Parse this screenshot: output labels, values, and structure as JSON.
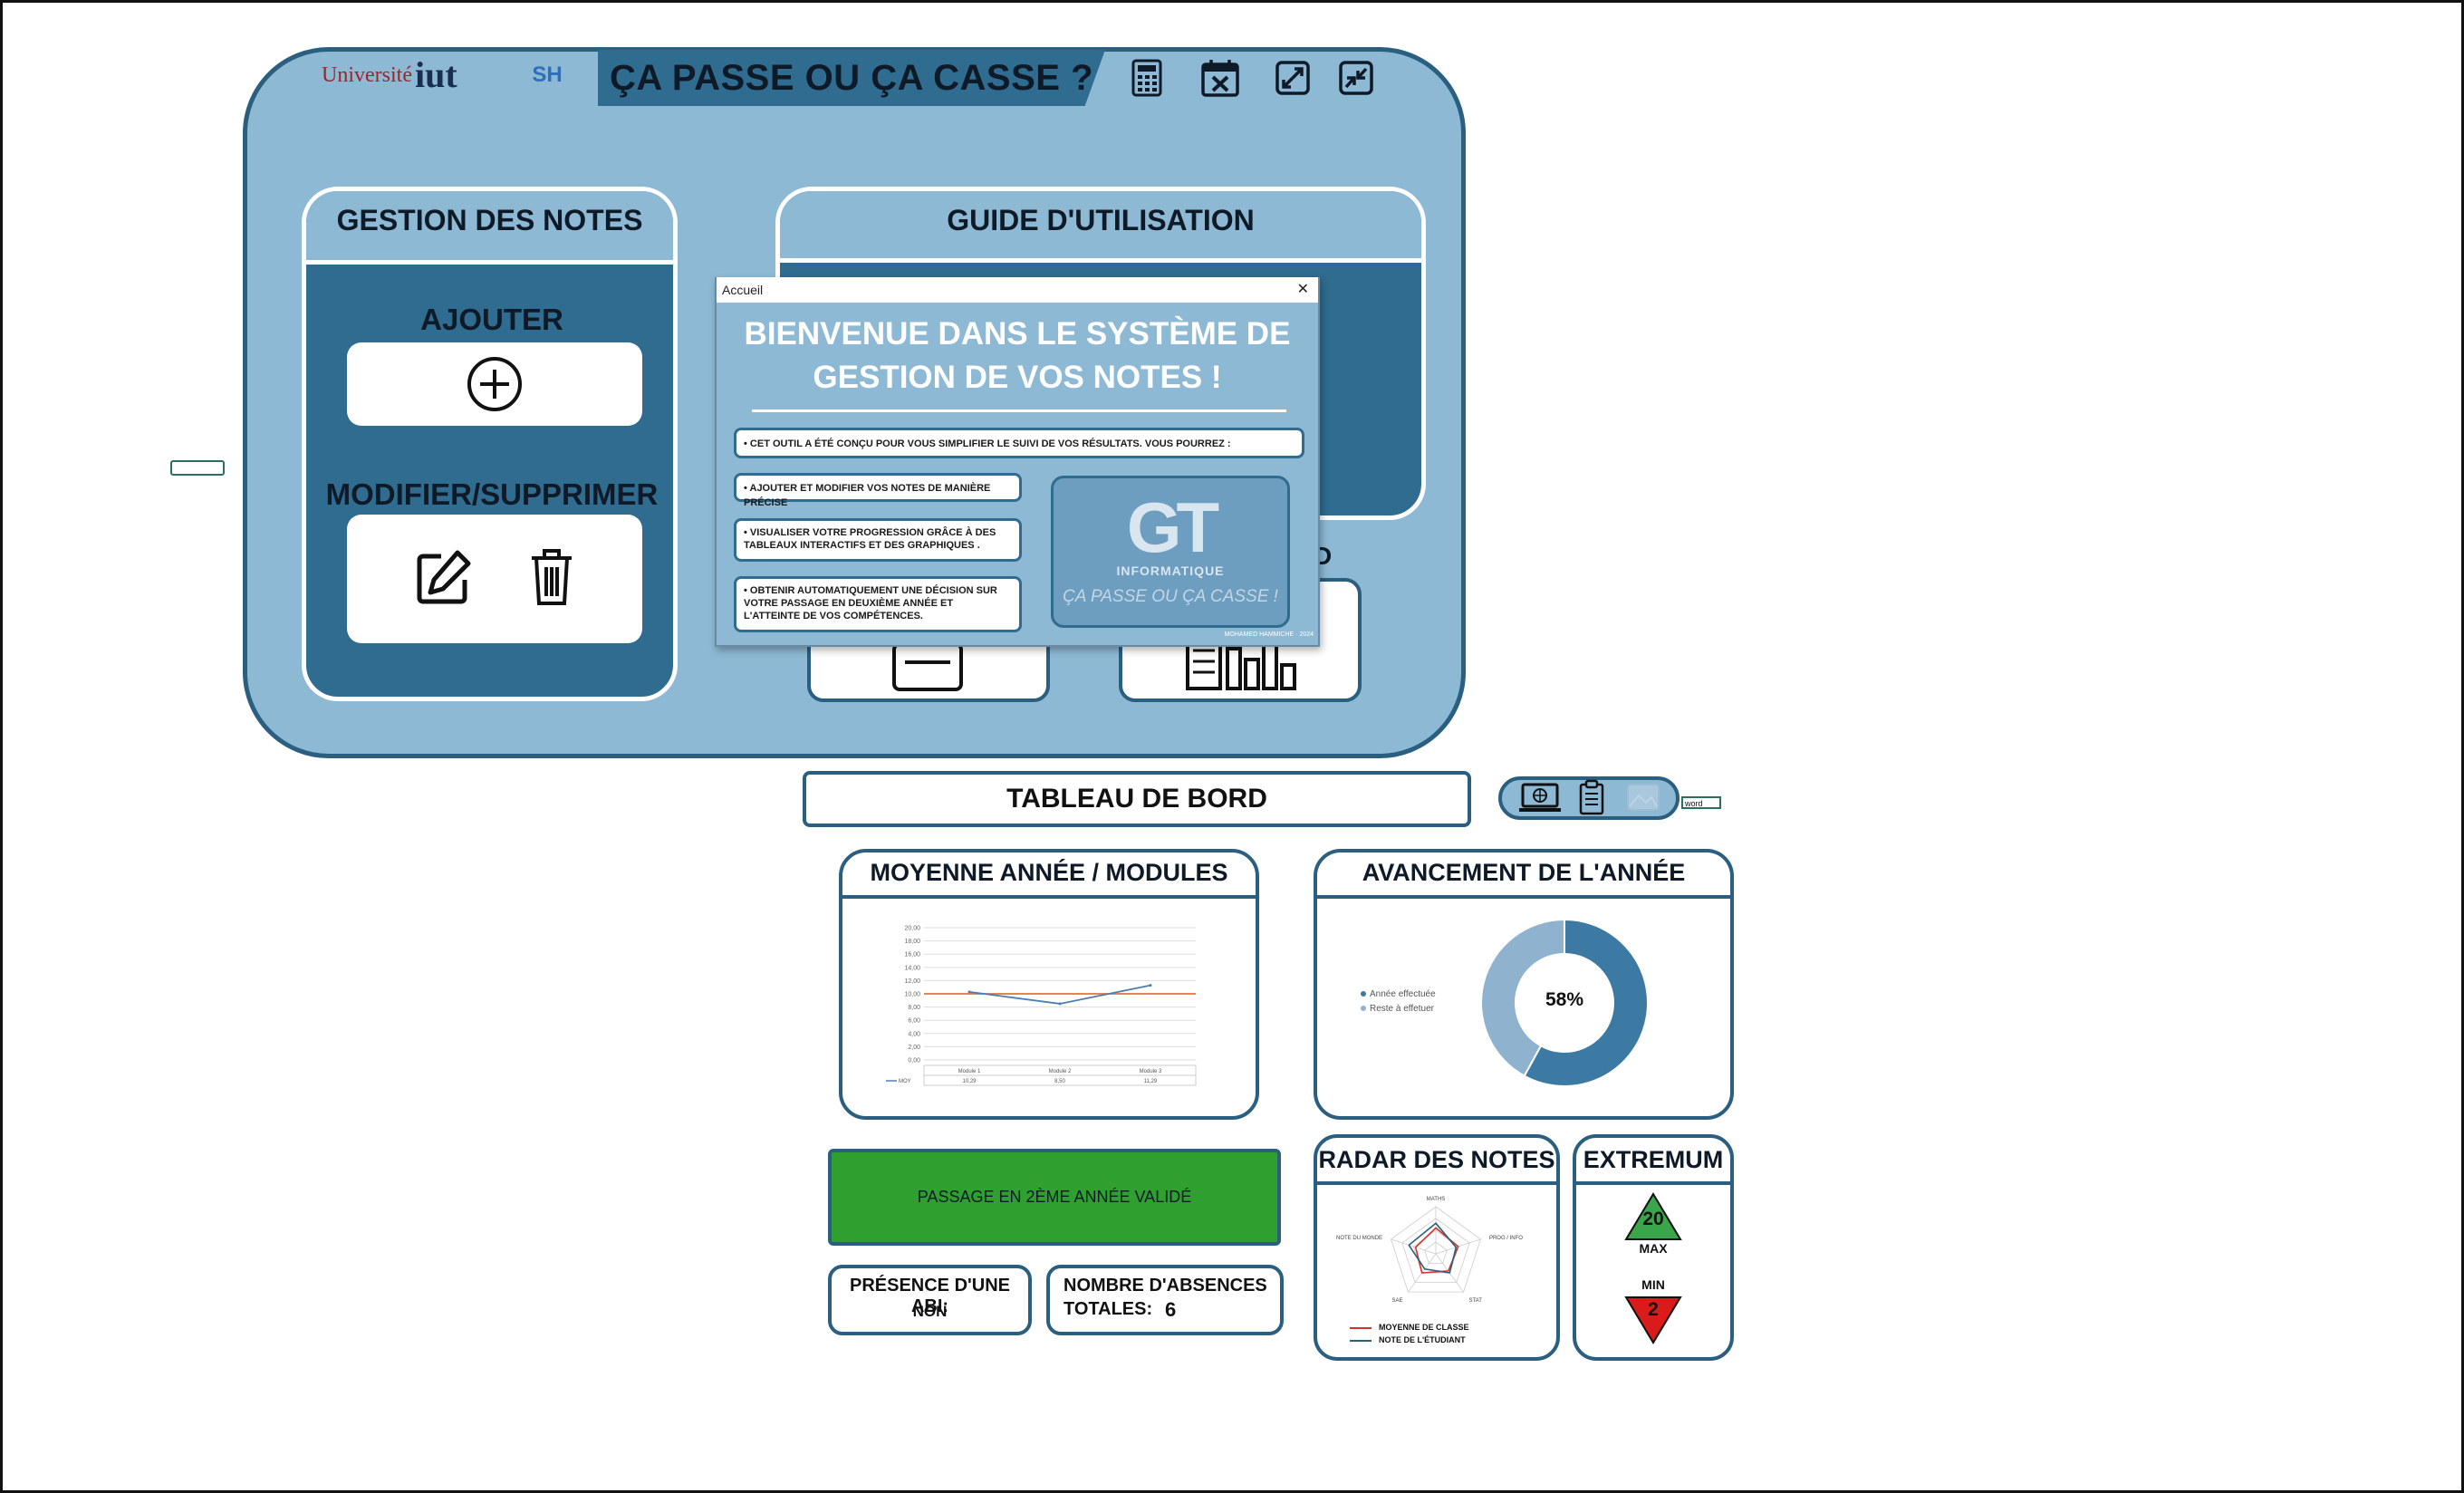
{
  "header": {
    "logo_university": "Université",
    "logo_iut": "iut",
    "logo_sh": "SH",
    "title": "ÇA PASSE OU ÇA CASSE ?",
    "icons": [
      "calculator-icon",
      "calendar-close-icon",
      "expand-icon",
      "shrink-icon"
    ]
  },
  "gestion": {
    "title": "GESTION DES NOTES",
    "ajouter": "AJOUTER",
    "ajouter_icon": "circle-plus-icon",
    "modifier": "MODIFIER/SUPPRIMER",
    "edit_icon": "edit-icon",
    "delete_icon": "trash-icon"
  },
  "guide": {
    "title": "GUIDE D'UTILISATION",
    "partial_label": "D"
  },
  "dialog": {
    "window_title": "Accueil",
    "close": "✕",
    "heading_line1": "BIENVENUE DANS LE SYSTÈME DE",
    "heading_line2": "GESTION DE VOS NOTES !",
    "intro": "• CET OUTIL A ÉTÉ CONÇU POUR VOUS SIMPLIFIER LE SUIVI DE VOS RÉSULTATS. VOUS POURREZ :",
    "b1": "• AJOUTER ET MODIFIER VOS NOTES DE MANIÈRE PRÉCISE",
    "b2": "• VISUALISER VOTRE PROGRESSION GRÂCE À DES TABLEAUX INTERACTIFS ET DES GRAPHIQUES .",
    "b3": "• OBTENIR AUTOMATIQUEMENT UNE DÉCISION SUR VOTRE PASSAGE EN DEUXIÈME ANNÉE ET L'ATTEINTE DE VOS COMPÉTENCES.",
    "brand_logo": "GT",
    "brand_sub": "INFORMATIQUE",
    "brand_tagline": "ÇA PASSE OU ÇA CASSE !",
    "footer": "MOHAMED HAMMICHE · 2024"
  },
  "dashboard": {
    "title": "TABLEAU DE BORD",
    "toolbar_icons": [
      "monitor-globe-icon",
      "clipboard-icon",
      "image-icon"
    ],
    "word_label": "word"
  },
  "moyenne": {
    "title": "MOYENNE ANNÉE / MODULES",
    "series_label": "MOY"
  },
  "chart_data": [
    {
      "type": "line",
      "title": "MOYENNE ANNÉE / MODULES",
      "categories": [
        "Module 1",
        "Module 2",
        "Module 3"
      ],
      "series": [
        {
          "name": "MOY",
          "values": [
            10.29,
            8.5,
            11.29
          ],
          "color": "#4a7fb0"
        },
        {
          "values": [
            10,
            10,
            10
          ],
          "color": "#e0733c"
        }
      ],
      "yticks": [
        "20,00",
        "18,00",
        "16,00",
        "14,00",
        "12,00",
        "10,00",
        "8,00",
        "6,00",
        "4,00",
        "2,00",
        "0,00"
      ],
      "table_values": [
        "10,29",
        "8,50",
        "11,29"
      ],
      "ylim": [
        0,
        20
      ]
    },
    {
      "type": "pie",
      "title": "AVANCEMENT DE L'ANNÉE",
      "labels": [
        "Année effectuée",
        "Reste à effetuer"
      ],
      "values": [
        58,
        42
      ],
      "colors": [
        "#3d7aa3",
        "#8fb3cf"
      ],
      "center_label": "58%"
    },
    {
      "type": "radar",
      "title": "RADAR DES NOTES",
      "axes": [
        "MATHS",
        "PROG / INFO",
        "STAT",
        "SAE",
        "NOTE DU MONDE"
      ],
      "series": [
        {
          "name": "MOYENNE DE CLASSE",
          "values": [
            11,
            10,
            9,
            10,
            9
          ],
          "color": "#d4322b"
        },
        {
          "name": "NOTE DE L'ÉTUDIANT",
          "values": [
            13,
            9,
            10,
            8,
            12
          ],
          "color": "#2a5f80"
        }
      ],
      "range": [
        0,
        20
      ]
    }
  ],
  "avancement": {
    "title": "AVANCEMENT DE L'ANNÉE",
    "legend1": "Année effectuée",
    "legend2": "Reste à effetuer",
    "center": "58%"
  },
  "passage": {
    "text": "PASSAGE EN 2ÈME ANNÉE VALIDÉ",
    "color": "#2fa02f"
  },
  "abi": {
    "label": "PRÉSENCE D'UNE ABI:",
    "value": "NON"
  },
  "absences": {
    "label1": "NOMBRE D'ABSENCES",
    "label2": "TOTALES:",
    "value": "6"
  },
  "radar": {
    "title": "RADAR DES NOTES",
    "legend1": "MOYENNE DE CLASSE",
    "legend2": "NOTE DE L'ÉTUDIANT"
  },
  "extremum": {
    "title": "EXTREMUM",
    "max_value": "20",
    "max_label": "MAX",
    "min_label": "MIN",
    "min_value": "2",
    "max_color": "#3aa54b",
    "min_color": "#d91b1b"
  }
}
